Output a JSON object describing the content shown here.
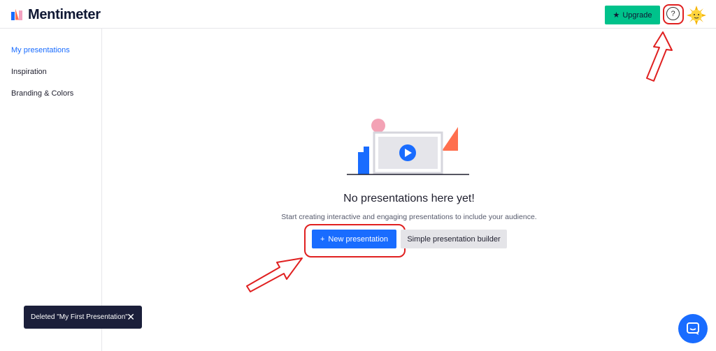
{
  "header": {
    "brand": "Mentimeter",
    "upgrade_label": "Upgrade",
    "help_glyph": "?",
    "upgrade_icon": "star-icon",
    "avatar_icon": "sun-avatar-icon"
  },
  "sidebar": {
    "items": [
      {
        "label": "My presentations",
        "active": true
      },
      {
        "label": "Inspiration",
        "active": false
      },
      {
        "label": "Branding & Colors",
        "active": false
      }
    ]
  },
  "main": {
    "empty_title": "No presentations here yet!",
    "empty_subtitle": "Start creating interactive and engaging presentations to include your audience.",
    "new_presentation_label": "New presentation",
    "new_presentation_icon": "plus-icon",
    "simple_builder_label": "Simple presentation builder"
  },
  "toast": {
    "message": "Deleted \"My First Presentation\"",
    "close_icon": "close-icon"
  },
  "chat": {
    "icon": "chat-icon"
  },
  "colors": {
    "primary": "#196cff",
    "upgrade": "#00c28b",
    "annotation": "#e02020",
    "toast_bg": "#1b1f3a"
  }
}
